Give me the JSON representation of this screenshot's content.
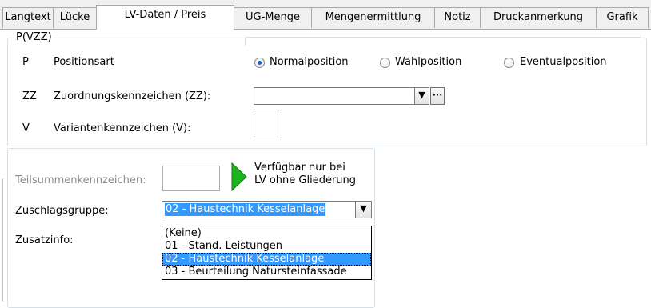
{
  "tabs": [
    {
      "label": "Langtext",
      "active": false
    },
    {
      "label": "Lücke",
      "active": false
    },
    {
      "label": "LV-Daten / Preis",
      "active": true
    },
    {
      "label": "UG-Menge",
      "active": false
    },
    {
      "label": "Mengenermittlung",
      "active": false
    },
    {
      "label": "Notiz",
      "active": false
    },
    {
      "label": "Druckanmerkung",
      "active": false
    },
    {
      "label": "Grafik",
      "active": false
    }
  ],
  "pvzz": {
    "legend": "P(VZZ)",
    "rows": [
      {
        "code": "P",
        "label": "Positionsart"
      },
      {
        "code": "ZZ",
        "label": "Zuordnungskennzeichen (ZZ):"
      },
      {
        "code": "V",
        "label": "Variantenkennzeichen (V):"
      }
    ],
    "positionsart_options": [
      {
        "label": "Normalposition",
        "checked": true
      },
      {
        "label": "Wahlposition",
        "checked": false
      },
      {
        "label": "Eventualposition",
        "checked": false
      }
    ],
    "zz_value": "",
    "zz_browse": "···",
    "v_value": ""
  },
  "lower": {
    "teilsummen_label": "Teilsummenkennzeichen:",
    "teilsummen_value": "",
    "hint_line1": "Verfügbar nur bei",
    "hint_line2": "LV ohne Gliederung",
    "zuschlag_label": "Zuschlagsgruppe:",
    "zuschlag_value": "02 - Haustechnik Kesselanlage",
    "zusatz_label": "Zusatzinfo:",
    "dropdown_options": [
      {
        "label": "(Keine)",
        "selected": false
      },
      {
        "label": "01 - Stand. Leistungen",
        "selected": false
      },
      {
        "label": "02 - Haustechnik Kesselanlage",
        "selected": true
      },
      {
        "label": "03 - Beurteilung Natursteinfassade",
        "selected": false
      }
    ]
  },
  "colors": {
    "selection": "#3399ff",
    "radio_dot": "#1a5fbf",
    "arrow_green": "#1db31d",
    "disabled_text": "#8c8c8c"
  }
}
